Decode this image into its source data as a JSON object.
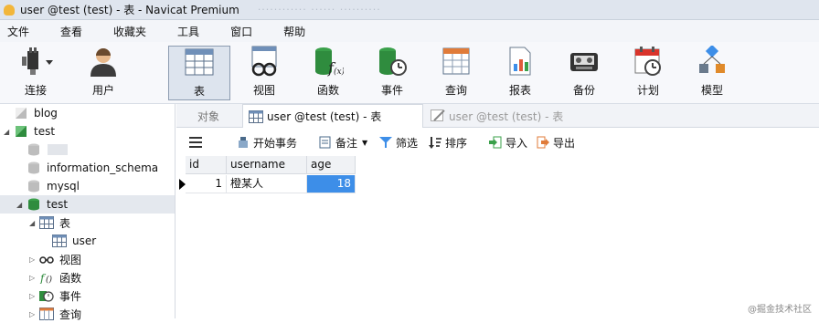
{
  "window": {
    "title": "user @test (test) - 表 - Navicat Premium",
    "blurred_text": "············ ······ ··········"
  },
  "menu": [
    "文件",
    "查看",
    "收藏夹",
    "工具",
    "窗口",
    "帮助"
  ],
  "toolbar": [
    {
      "label": "连接",
      "icon": "connection-icon"
    },
    {
      "label": "用户",
      "icon": "user-icon"
    },
    {
      "label": "表",
      "icon": "table-icon",
      "active": true
    },
    {
      "label": "视图",
      "icon": "view-icon"
    },
    {
      "label": "函数",
      "icon": "function-icon"
    },
    {
      "label": "事件",
      "icon": "event-icon"
    },
    {
      "label": "查询",
      "icon": "query-icon"
    },
    {
      "label": "报表",
      "icon": "report-icon"
    },
    {
      "label": "备份",
      "icon": "backup-icon"
    },
    {
      "label": "计划",
      "icon": "schedule-icon"
    },
    {
      "label": "模型",
      "icon": "model-icon"
    }
  ],
  "tree": [
    {
      "label": "blog"
    },
    {
      "label": "test"
    },
    {
      "label": ""
    },
    {
      "label": "information_schema"
    },
    {
      "label": "mysql"
    },
    {
      "label": "test"
    },
    {
      "label": "表"
    },
    {
      "label": "user"
    },
    {
      "label": "视图"
    },
    {
      "label": "函数"
    },
    {
      "label": "事件"
    },
    {
      "label": "查询"
    }
  ],
  "tabs": {
    "objects": "对象",
    "active": "user @test (test) - 表",
    "inactive": "user @test (test) - 表"
  },
  "object_toolbar": {
    "begin_transaction": "开始事务",
    "memo": "备注",
    "filter": "筛选",
    "sort": "排序",
    "import": "导入",
    "export": "导出"
  },
  "table": {
    "columns": [
      "id",
      "username",
      "age"
    ],
    "rows": [
      {
        "id": "1",
        "username": "橙某人",
        "age": "18"
      }
    ]
  },
  "watermark": "@掘金技术社区",
  "colors": {
    "selection": "#3d8ee8",
    "tree_selected": "#e4e8ee",
    "titlebar": "#dfe5ee"
  }
}
